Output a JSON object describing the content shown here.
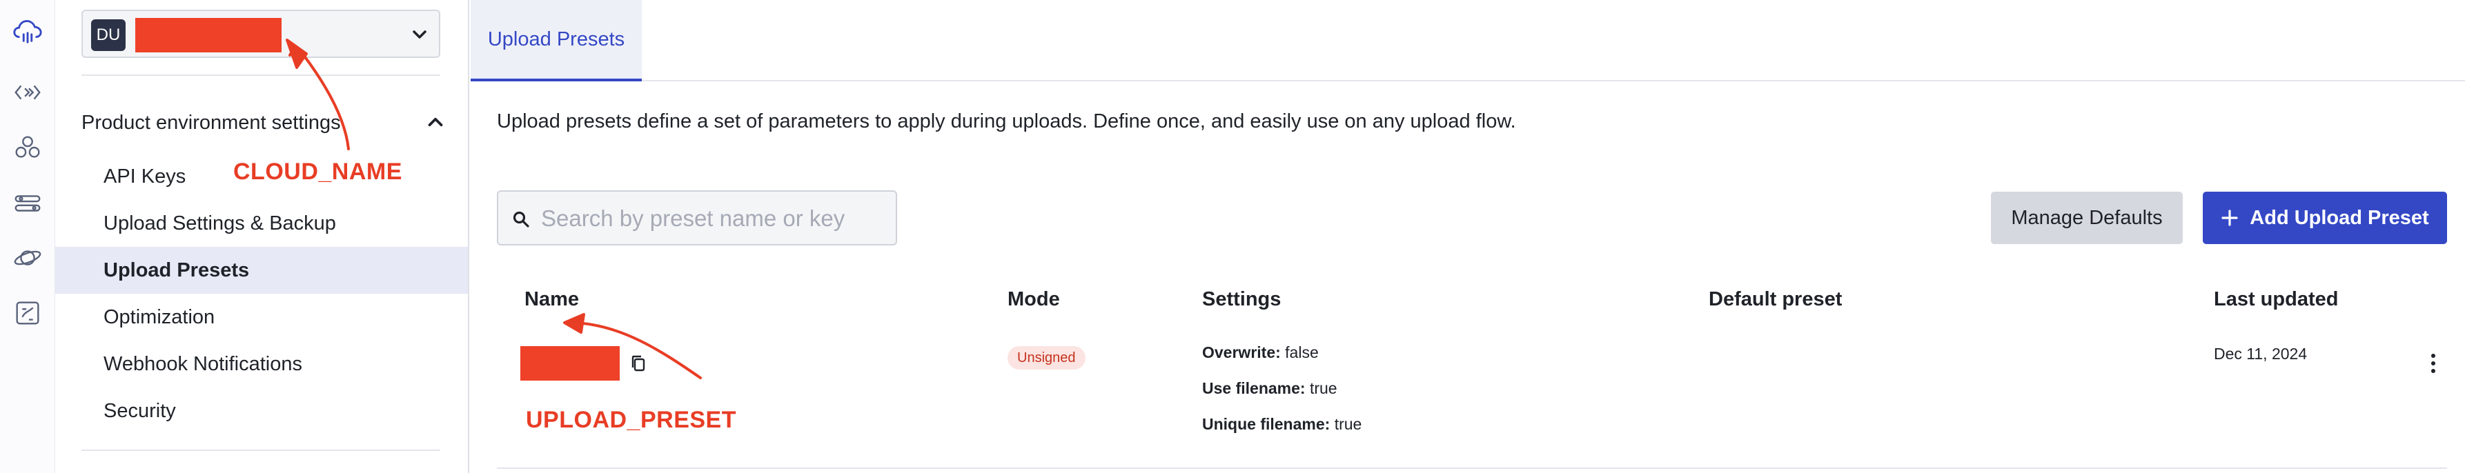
{
  "environment": {
    "avatar_initials": "DU"
  },
  "sidebar": {
    "section_title": "Product environment settings",
    "items": [
      {
        "label": "API Keys",
        "active": false
      },
      {
        "label": "Upload Settings & Backup",
        "active": false
      },
      {
        "label": "Upload Presets",
        "active": true
      },
      {
        "label": "Optimization",
        "active": false
      },
      {
        "label": "Webhook Notifications",
        "active": false
      },
      {
        "label": "Security",
        "active": false
      }
    ]
  },
  "annotations": {
    "cloud_name": "CLOUD_NAME",
    "upload_preset": "UPLOAD_PRESET"
  },
  "main": {
    "tab_label": "Upload Presets",
    "intro": "Upload presets define a set of parameters to apply during uploads. Define once, and easily use on any upload flow.",
    "search_placeholder": "Search by preset name or key",
    "manage_defaults_label": "Manage Defaults",
    "add_preset_label": "Add Upload Preset",
    "table": {
      "headers": {
        "name": "Name",
        "mode": "Mode",
        "settings": "Settings",
        "default_preset": "Default preset",
        "last_updated": "Last updated"
      },
      "rows": [
        {
          "mode": "Unsigned",
          "settings": [
            {
              "key": "Overwrite:",
              "value": "false"
            },
            {
              "key": "Use filename:",
              "value": "true"
            },
            {
              "key": "Unique filename:",
              "value": "true"
            }
          ],
          "default_preset": "",
          "last_updated": "Dec 11, 2024"
        }
      ]
    }
  },
  "colors": {
    "accent": "#3448c5",
    "redaction": "#ee4128",
    "annotation": "#e83d25",
    "active_nav_bg": "#e7e9f6",
    "badge_bg": "#fbe4e1",
    "badge_text": "#c6321f"
  }
}
